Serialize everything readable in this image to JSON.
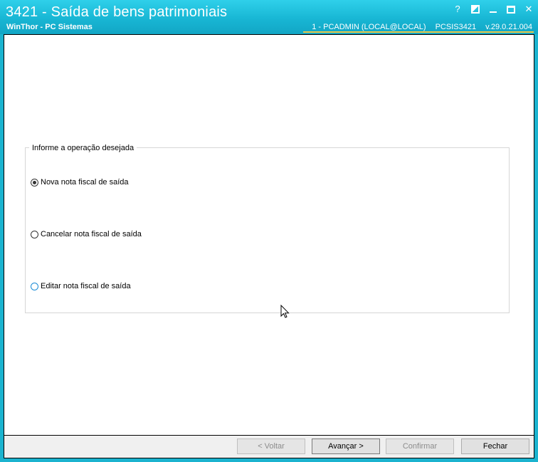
{
  "window": {
    "title": "3421 - Saída de bens patrimoniais",
    "subtitle": "WinThor - PC Sistemas",
    "session_user": "1 - PCADMIN (LOCAL@LOCAL)",
    "session_program": "PCSIS3421",
    "session_version": "v.29.0.21.004",
    "help_glyph": "?"
  },
  "groupbox": {
    "legend": "Informe a operação desejada",
    "options": [
      {
        "label": "Nova nota fiscal de saída",
        "checked": true
      },
      {
        "label": "Cancelar nota fiscal de saída",
        "checked": false
      },
      {
        "label": "Editar nota fiscal de saída",
        "checked": false
      }
    ]
  },
  "buttons": {
    "back": "< Voltar",
    "next": "Avançar >",
    "confirm": "Confirmar",
    "close": "Fechar"
  },
  "colors": {
    "titlebar": "#1bb3cf",
    "accent_line": "#e8c94a"
  },
  "icons": [
    "help-icon",
    "restore-icon",
    "minimize-icon",
    "maximize-icon",
    "close-icon",
    "mouse-pointer-icon"
  ]
}
